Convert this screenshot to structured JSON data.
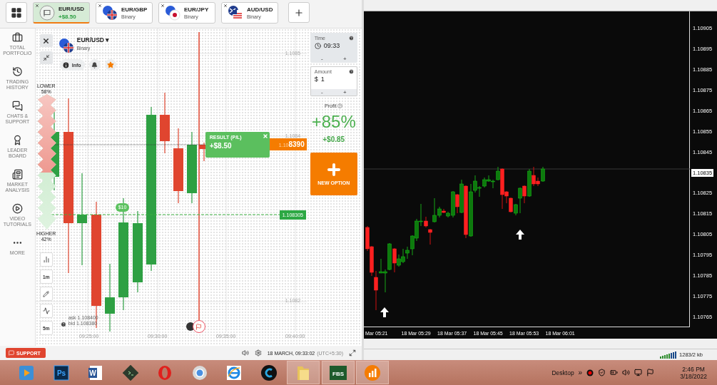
{
  "tabs_bar": {
    "tabs": [
      {
        "symbol": "EUR/USD",
        "subtitle": "+$8.50",
        "selected": true,
        "kind": "checkered"
      },
      {
        "symbol": "EUR/GBP",
        "subtitle": "Binary",
        "selected": false,
        "kind": "gbp"
      },
      {
        "symbol": "EUR/JPY",
        "subtitle": "Binary",
        "selected": false,
        "kind": "jpy"
      },
      {
        "symbol": "AUD/USD",
        "subtitle": "Binary",
        "selected": false,
        "kind": "aud"
      }
    ]
  },
  "sidebar": {
    "items": [
      {
        "label": "TOTAL PORTFOLIO",
        "kind": "portfolio"
      },
      {
        "label": "TRADING HISTORY",
        "kind": "history"
      },
      {
        "label": "CHATS & SUPPORT",
        "kind": "chat"
      },
      {
        "label": "LEADER BOARD",
        "kind": "leader"
      },
      {
        "label": "MARKET ANALYSIS",
        "kind": "analysis"
      },
      {
        "label": "VIDEO TUTORIALS",
        "kind": "video"
      },
      {
        "label": "MORE",
        "kind": "more"
      }
    ]
  },
  "asset": {
    "symbol": "EUR/USD",
    "caret": "▾",
    "type": "Binary",
    "info_label": "Info",
    "favorite": true
  },
  "sentiment": {
    "lower_label": "LOWER",
    "lower_percent": "58%",
    "higher_label": "HIGHER",
    "higher_percent": "42%",
    "level": 0.58
  },
  "chart": {
    "price_labels": [
      {
        "label": "1.1085",
        "kind": "top"
      },
      {
        "label": "1.1084",
        "kind": "upper"
      },
      {
        "label": "1.1082",
        "kind": "bottom"
      }
    ],
    "time_labels": [
      "09:25:00",
      "09:30:00",
      "09:35:00",
      "09:40:00"
    ],
    "strike": {
      "amount": "$10",
      "price": "1.108305"
    },
    "current_price": {
      "prefix": "1.10",
      "suffix": "8390"
    },
    "result": {
      "title": "RESULT (P/L)",
      "value": "+$8.50"
    },
    "quote": {
      "ask": "ask 1.108400",
      "bid": "bid 1.108380"
    },
    "tools": [
      {
        "kind": "chart-type"
      },
      {
        "kind": "text",
        "label": "1m"
      },
      {
        "kind": "pencil"
      },
      {
        "kind": "indicator"
      },
      {
        "kind": "text",
        "label": "5m"
      }
    ]
  },
  "trade_panel": {
    "time": {
      "label": "Time",
      "value": "09:33",
      "minus": "-",
      "plus": "+"
    },
    "amount": {
      "label": "Amount",
      "currency": "$",
      "value": "1",
      "minus": "-",
      "plus": "+"
    },
    "profit": {
      "label": "Profit",
      "percent": "+85%",
      "value": "+$0.85"
    },
    "new_option": {
      "label": "NEW OPTION"
    }
  },
  "bottom_bar": {
    "support": "SUPPORT",
    "datetime": "18 MARCH, 09:33:02",
    "timezone": "(UTC+5:30)"
  },
  "mt4": {
    "price_axis": [
      {
        "label": "1.10905",
        "highlighted": false
      },
      {
        "label": "1.10895",
        "highlighted": false
      },
      {
        "label": "1.10885",
        "highlighted": false
      },
      {
        "label": "1.10875",
        "highlighted": false
      },
      {
        "label": "1.10865",
        "highlighted": false
      },
      {
        "label": "1.10855",
        "highlighted": false
      },
      {
        "label": "1.10845",
        "highlighted": false
      },
      {
        "label": "1.10835",
        "highlighted": true
      },
      {
        "label": "1.10825",
        "highlighted": false
      },
      {
        "label": "1.10815",
        "highlighted": false
      },
      {
        "label": "1.10805",
        "highlighted": false
      },
      {
        "label": "1.10795",
        "highlighted": false
      },
      {
        "label": "1.10785",
        "highlighted": false
      },
      {
        "label": "1.10775",
        "highlighted": false
      },
      {
        "label": "1.10765",
        "highlighted": false
      }
    ],
    "time_axis": [
      "Mar 05:21",
      "18 Mar 05:29",
      "18 Mar 05:37",
      "18 Mar 05:45",
      "18 Mar 05:53",
      "18 Mar 06:01"
    ],
    "status": "1283/2 kb"
  },
  "taskbar": {
    "apps": [
      {
        "kind": "media",
        "open": false
      },
      {
        "kind": "photoshop",
        "label": "Ps",
        "open": false
      },
      {
        "kind": "word",
        "label": "W",
        "open": false
      },
      {
        "kind": "terminal",
        "open": false
      },
      {
        "kind": "opera",
        "open": false
      },
      {
        "kind": "chrome",
        "open": false
      },
      {
        "kind": "ie",
        "open": false
      },
      {
        "kind": "ccleaner",
        "open": false
      },
      {
        "kind": "folder",
        "open": true
      },
      {
        "kind": "fbs",
        "label": "FBS",
        "open": true
      },
      {
        "kind": "iq",
        "open": true
      }
    ],
    "desktop_label": "Desktop",
    "overflow": "»",
    "time": "2:46 PM",
    "date": "3/18/2022"
  }
}
